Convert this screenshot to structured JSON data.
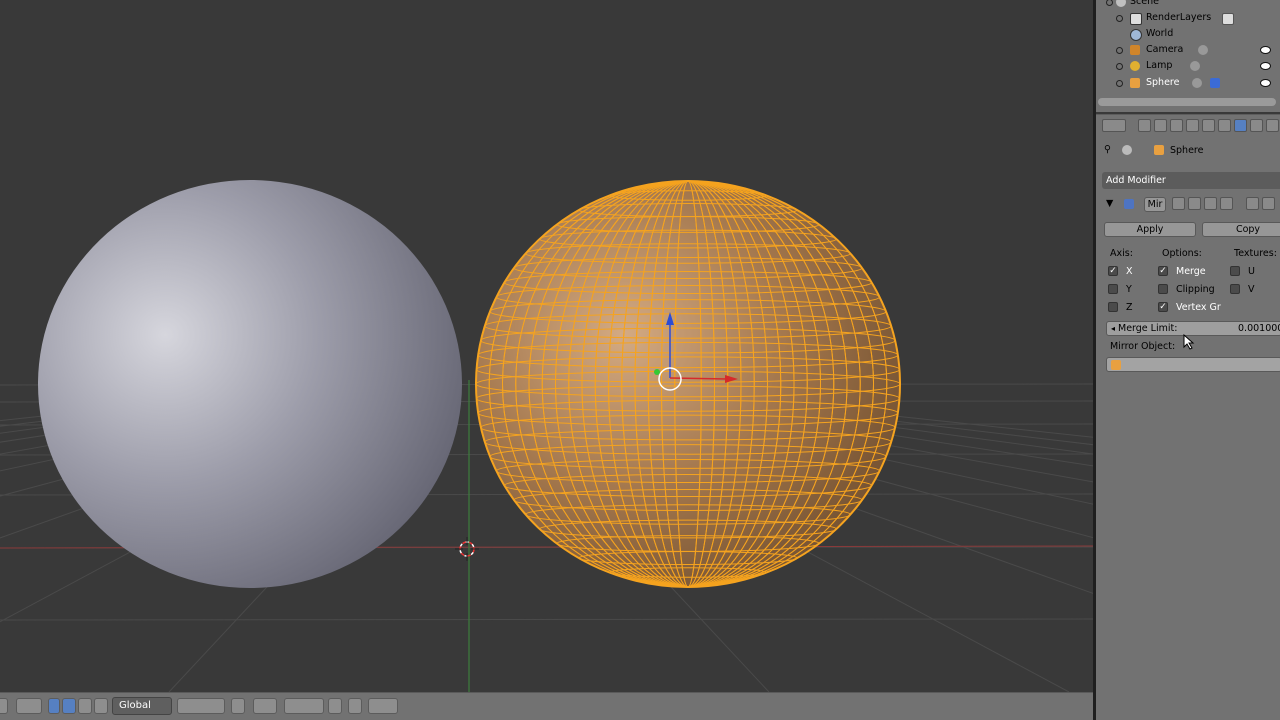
{
  "outliner": {
    "items": [
      {
        "label": "Scene",
        "icon": "scene-icon"
      },
      {
        "label": "RenderLayers",
        "icon": "render-layers-icon"
      },
      {
        "label": "World",
        "icon": "world-icon"
      },
      {
        "label": "Camera",
        "icon": "camera-icon"
      },
      {
        "label": "Lamp",
        "icon": "lamp-icon"
      },
      {
        "label": "Sphere",
        "icon": "mesh-icon"
      }
    ]
  },
  "properties": {
    "breadcrumb_object": "Sphere",
    "add_modifier_label": "Add Modifier",
    "modifier": {
      "name_short": "Mir",
      "apply_label": "Apply",
      "copy_label": "Copy",
      "axis_label": "Axis:",
      "options_label": "Options:",
      "textures_label": "Textures:",
      "axis": [
        {
          "label": "X",
          "checked": true
        },
        {
          "label": "Y",
          "checked": false
        },
        {
          "label": "Z",
          "checked": false
        }
      ],
      "options": [
        {
          "label": "Merge",
          "checked": true
        },
        {
          "label": "Clipping",
          "checked": false
        },
        {
          "label": "Vertex Gr",
          "checked": true
        }
      ],
      "textures": [
        {
          "label": "U",
          "checked": false
        },
        {
          "label": "V",
          "checked": false
        }
      ],
      "merge_limit_label": "Merge Limit:",
      "merge_limit_value": "0.001000",
      "mirror_object_label": "Mirror Object:",
      "mirror_object_value": ""
    }
  },
  "viewport_header": {
    "orientation": "Global"
  },
  "colors": {
    "viewport_bg": "#393939",
    "panel_bg": "#727272",
    "selection_orange": "#f5a31f",
    "active_blue": "#5680c2"
  }
}
